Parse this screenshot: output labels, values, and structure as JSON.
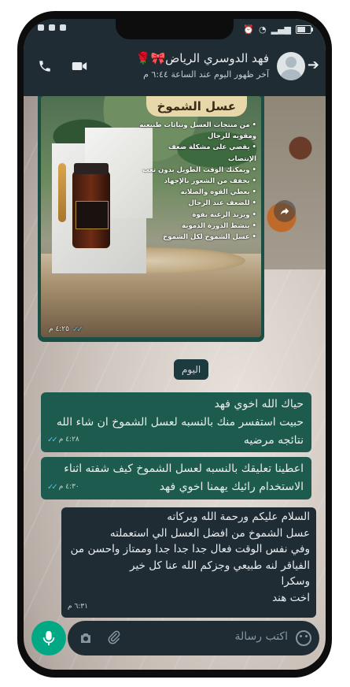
{
  "status_bar": {
    "icons_right": [
      "alarm-icon",
      "wifi-icon",
      "signal-icon",
      "battery-icon"
    ],
    "icons_left": [
      "notification-icons"
    ]
  },
  "header": {
    "contact_name": "فهد الدوسري الرياض🎀🌹",
    "last_seen": "آخر ظهور اليوم عند الساعة ٦:٤٤ م",
    "back_icon": "arrow-left-icon",
    "call_icon": "phone-icon",
    "video_icon": "video-icon"
  },
  "image_message": {
    "title": "عسل الشموخ",
    "bullets": [
      "من منتجات العسل ونباتات طبيعيه ومقويه للرجال",
      "يقضي على مشكلة ضعف الإنتصاب",
      "ويمكنك الوقت الطويل بدون تعب",
      "يخفف من الشعور بالإجهاد",
      "يعطي القوه والصلابه",
      "للضعف عند الرجال",
      "ويزيد الرغبة بقوة",
      "ينشط الدورة الدموية",
      "عسل الشموخ لكل الشموخ"
    ],
    "time": "٤:٢٥ م"
  },
  "day_separator": "اليوم",
  "messages": [
    {
      "lines": [
        "حياك الله اخوي فهد",
        "حبيت استفسر منك بالنسبه لعسل الشموخ ان شاء الله",
        "نتائجه مرضيه"
      ],
      "time": "٤:٢٨ م",
      "outgoing": true
    },
    {
      "lines": [
        "اعطينا تعليقك بالنسبه لعسل الشموخ كيف شفته اثناء",
        "الاستخدام رائيك يهمنا اخوي فهد"
      ],
      "time": "٤:٣٠ م",
      "outgoing": true
    },
    {
      "lines": [
        "السلام عليكم  ورحمة الله وبركاته",
        "عسل الشموخ من افضل العسل الي  استعملته",
        "وفي نفس الوقت فعال جدا جدا جدا وممتاز واحسن من",
        "الفياقر لنه طبيعي وجزكم الله عنا كل خير",
        "وسكرا",
        "اخت هند"
      ],
      "time": "٦:٣١ م",
      "outgoing": false
    }
  ],
  "input": {
    "placeholder": "اكتب رسالة",
    "emoji_icon": "emoji-icon",
    "attach_icon": "paperclip-icon",
    "camera_icon": "camera-icon",
    "mic_icon": "microphone-icon"
  },
  "colors": {
    "header": "#1f2c33",
    "outgoing_bubble": "#1e5b4f",
    "incoming_bubble": "#1f2c33",
    "accent": "#00a884",
    "read_ticks": "#53bdeb"
  }
}
